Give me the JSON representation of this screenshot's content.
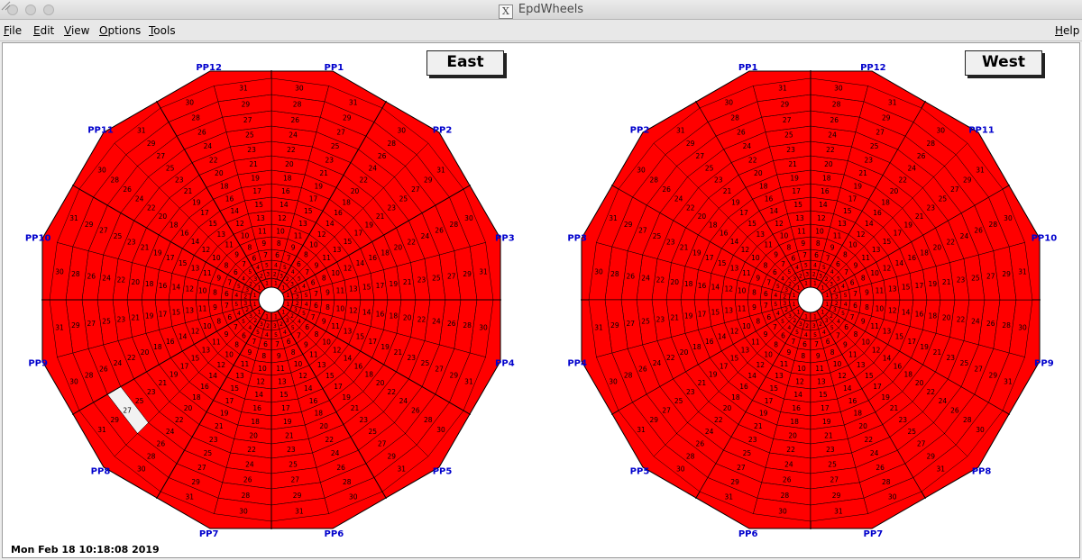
{
  "window": {
    "title": "EpdWheels",
    "x_icon": "x11-icon"
  },
  "menubar": {
    "items": [
      {
        "id": "file",
        "prefix": "F",
        "rest": "ile"
      },
      {
        "id": "edit",
        "prefix": "E",
        "rest": "dit"
      },
      {
        "id": "view",
        "prefix": "V",
        "rest": "iew"
      },
      {
        "id": "options",
        "prefix": "O",
        "rest": "ptions"
      },
      {
        "id": "tools",
        "prefix": "T",
        "rest": "ools"
      }
    ],
    "help": {
      "prefix": "H",
      "rest": "elp"
    }
  },
  "colors": {
    "tile_fill": "#ff0000",
    "tile_off": "#f2f2f2",
    "pp_label": "#0000cc",
    "line": "#000000"
  },
  "wheels": [
    {
      "name": "East",
      "pp_labels": [
        "PP1",
        "PP2",
        "PP3",
        "PP4",
        "PP5",
        "PP6",
        "PP7",
        "PP8",
        "PP9",
        "PP10",
        "PP11",
        "PP12"
      ],
      "direction": "clockwise",
      "off_tiles": [
        {
          "pp": "PP8",
          "tile": 27
        }
      ]
    },
    {
      "name": "West",
      "pp_labels": [
        "PP1",
        "PP2",
        "PP3",
        "PP4",
        "PP5",
        "PP6",
        "PP7",
        "PP8",
        "PP9",
        "PP10",
        "PP11",
        "PP12"
      ],
      "direction": "counterclockwise",
      "off_tiles": []
    }
  ],
  "tiles_per_sector": 31,
  "status_text": "Mon Feb 18 10:18:08 2019"
}
